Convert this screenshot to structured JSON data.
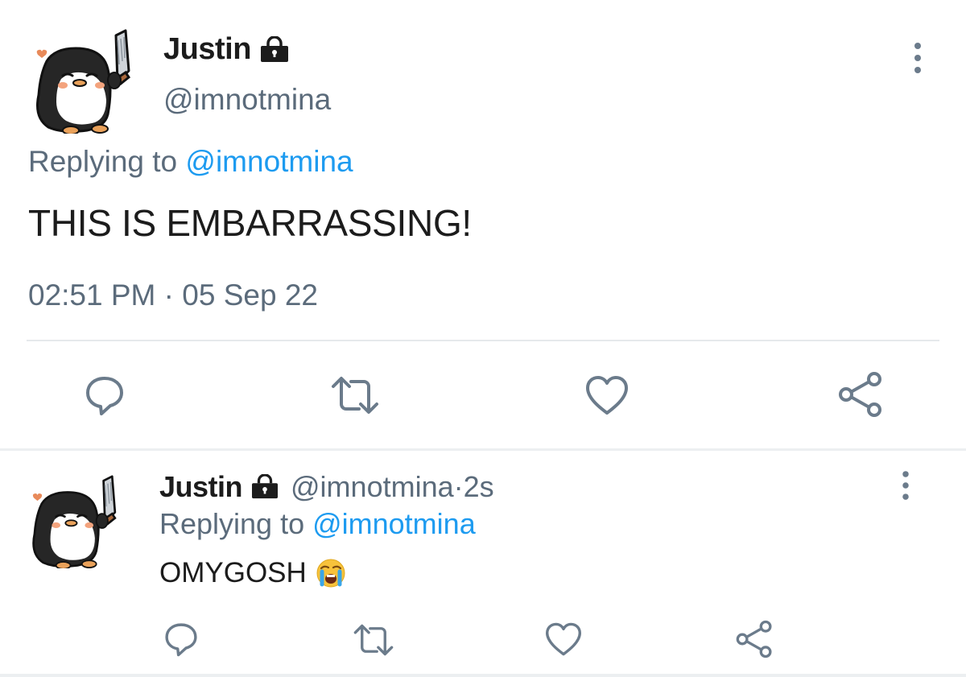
{
  "main_tweet": {
    "author_name": "Justin",
    "author_handle": "@imnotmina",
    "replying_prefix": "Replying to ",
    "replying_to": "@imnotmina",
    "text": "THIS IS EMBARRASSING!",
    "time": "02:51 PM",
    "separator": " · ",
    "date": "05 Sep 22",
    "icons": {
      "protected": "lock-icon",
      "more": "more-vertical-icon",
      "reply": "reply-icon",
      "retweet": "retweet-icon",
      "like": "heart-icon",
      "share": "share-icon"
    }
  },
  "reply_tweet": {
    "author_name": "Justin",
    "author_handle": "@imnotmina",
    "separator": " · ",
    "age": "2s",
    "replying_prefix": "Replying to ",
    "replying_to": "@imnotmina",
    "text": "OMYGOSH",
    "emoji": "loudly-crying-face-emoji"
  },
  "colors": {
    "text": "#1c1c1c",
    "secondary": "#5b6b7b",
    "link": "#1d9bf0",
    "icon": "#6b7b8b",
    "divider": "#e6e9ec"
  }
}
